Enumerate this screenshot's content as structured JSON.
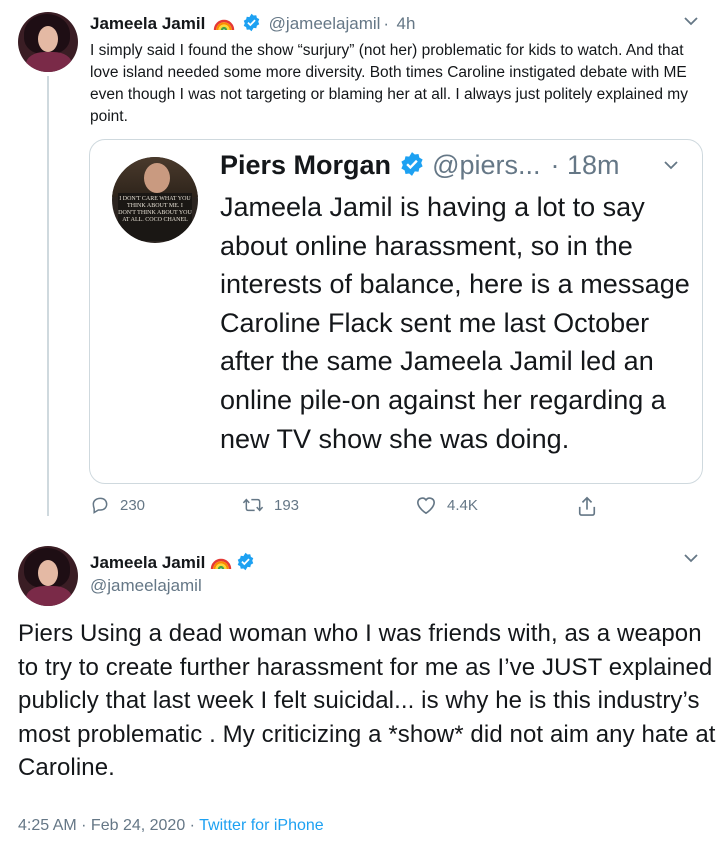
{
  "tweet1": {
    "display_name": "Jameela Jamil",
    "handle": "@jameelajamil",
    "separator": "·",
    "time": "4h",
    "body": "I simply said I found the show “surjury” (not her) problematic for kids to watch. And that love island needed some more diversity. Both times Caroline instigated debate with ME even though I was not targeting or blaming her at all. I always just politely explained my point."
  },
  "quote": {
    "display_name": "Piers Morgan",
    "handle": "@piers...",
    "time": "· 18m",
    "avatar_sign_text": "I don't care what you think about me. I don't think about you at all. Coco Chanel",
    "body": "Jameela Jamil is having a lot to say about online harassment, so in the interests of balance, here is a message Caroline Flack sent me last October after the same Jameela Jamil led an online pile-on against her regarding a new TV show she was doing."
  },
  "actions": {
    "reply_count": "230",
    "retweet_count": "193",
    "like_count": "4.4K"
  },
  "tweet2": {
    "display_name": "Jameela Jamil",
    "handle": "@jameelajamil",
    "body": "Piers Using a dead woman who I was friends with, as a weapon to try to create further harassment for me as I’ve JUST explained publicly that last week I felt suicidal... is why he is this industry’s most problematic . My criticizing a *show* did not aim any hate at Caroline.",
    "timestamp": "4:25 AM · Feb 24, 2020 · ",
    "source": "Twitter for iPhone"
  },
  "colors": {
    "accent": "#1da1f2",
    "muted_text": "#657786",
    "border": "#cfd9de",
    "text": "#14171a"
  },
  "icons": [
    "rainbow-emoji-icon",
    "verified-badge-icon",
    "chevron-down-icon",
    "reply-icon",
    "retweet-icon",
    "like-icon",
    "share-icon"
  ]
}
